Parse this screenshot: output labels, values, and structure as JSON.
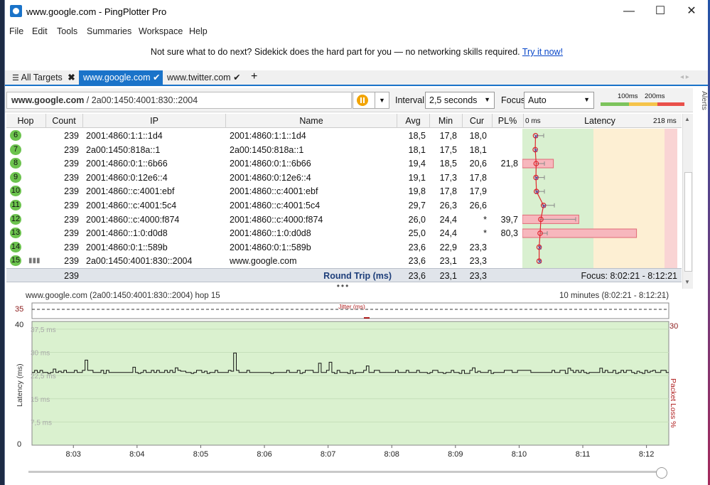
{
  "window": {
    "title": "www.google.com - PingPlotter Pro",
    "minimize": "—",
    "maximize": "☐",
    "close": "✕"
  },
  "menu": [
    "File",
    "Edit",
    "Tools",
    "Summaries",
    "Workspace",
    "Help"
  ],
  "banner": {
    "text": "Not sure what to do next? Sidekick does the hard part for you — no networking skills required.",
    "link": "Try it now!"
  },
  "tabs": {
    "all_targets": "All Targets",
    "items": [
      {
        "label": "www.google.com",
        "active": true
      },
      {
        "label": "www.twitter.com",
        "active": false
      }
    ],
    "add": "+"
  },
  "toolbar": {
    "target": "www.google.com",
    "target_ip": " / 2a00:1450:4001:830::2004",
    "interval_label": "Interval",
    "interval_value": "2,5 seconds",
    "focus_label": "Focus",
    "focus_value": "Auto",
    "scale_100": "100ms",
    "scale_200": "200ms"
  },
  "alerts": "Alerts",
  "columns": {
    "hop": "Hop",
    "count": "Count",
    "ip": "IP",
    "name": "Name",
    "avg": "Avg",
    "min": "Min",
    "cur": "Cur",
    "pl": "PL%",
    "lat_min": "0 ms",
    "latency": "Latency",
    "lat_max": "218 ms"
  },
  "hops": [
    {
      "hop": "6",
      "count": "239",
      "ip": "2001:4860:1:1::1d4",
      "name": "2001:4860:1:1::1d4",
      "avg": "18,5",
      "min": "17,8",
      "cur": "18,0",
      "pl": "",
      "avg_ms": 18.5,
      "min_ms": 17.8,
      "max_ms": 30,
      "pl_pct": 0
    },
    {
      "hop": "7",
      "count": "239",
      "ip": "2a00:1450:818a::1",
      "name": "2a00:1450:818a::1",
      "avg": "18,1",
      "min": "17,5",
      "cur": "18,1",
      "pl": "",
      "avg_ms": 18.1,
      "min_ms": 17.5,
      "max_ms": 18.5,
      "pl_pct": 0
    },
    {
      "hop": "8",
      "count": "239",
      "ip": "2001:4860:0:1::6b66",
      "name": "2001:4860:0:1::6b66",
      "avg": "19,4",
      "min": "18,5",
      "cur": "20,6",
      "pl": "21,8",
      "avg_ms": 19.4,
      "min_ms": 18.5,
      "max_ms": 31,
      "pl_pct": 21.8
    },
    {
      "hop": "9",
      "count": "239",
      "ip": "2001:4860:0:12e6::4",
      "name": "2001:4860:0:12e6::4",
      "avg": "19,1",
      "min": "17,3",
      "cur": "17,8",
      "pl": "",
      "avg_ms": 19.1,
      "min_ms": 17.3,
      "max_ms": 31,
      "pl_pct": 0
    },
    {
      "hop": "10",
      "count": "239",
      "ip": "2001:4860::c:4001:ebf",
      "name": "2001:4860::c:4001:ebf",
      "avg": "19,8",
      "min": "17,8",
      "cur": "17,9",
      "pl": "",
      "avg_ms": 19.8,
      "min_ms": 17.8,
      "max_ms": 31,
      "pl_pct": 0
    },
    {
      "hop": "11",
      "count": "239",
      "ip": "2001:4860::c:4001:5c4",
      "name": "2001:4860::c:4001:5c4",
      "avg": "29,7",
      "min": "26,3",
      "cur": "26,6",
      "pl": "",
      "avg_ms": 29.7,
      "min_ms": 26.3,
      "max_ms": 45,
      "pl_pct": 0
    },
    {
      "hop": "12",
      "count": "239",
      "ip": "2001:4860::c:4000:f874",
      "name": "2001:4860::c:4000:f874",
      "avg": "26,0",
      "min": "24,4",
      "cur": "*",
      "pl": "39,7",
      "avg_ms": 26.0,
      "min_ms": 24.4,
      "max_ms": 75,
      "pl_pct": 39.7
    },
    {
      "hop": "13",
      "count": "239",
      "ip": "2001:4860::1:0:d0d8",
      "name": "2001:4860::1:0:d0d8",
      "avg": "25,0",
      "min": "24,4",
      "cur": "*",
      "pl": "80,3",
      "avg_ms": 25.0,
      "min_ms": 24.4,
      "max_ms": 35,
      "pl_pct": 80.3
    },
    {
      "hop": "14",
      "count": "239",
      "ip": "2001:4860:0:1::589b",
      "name": "2001:4860:0:1::589b",
      "avg": "23,6",
      "min": "22,9",
      "cur": "23,3",
      "pl": "",
      "avg_ms": 23.6,
      "min_ms": 22.9,
      "max_ms": 25,
      "pl_pct": 0
    },
    {
      "hop": "15",
      "count": "239",
      "ip": "2a00:1450:4001:830::2004",
      "name": "www.google.com",
      "avg": "23,6",
      "min": "23,1",
      "cur": "23,3",
      "pl": "",
      "avg_ms": 23.6,
      "min_ms": 23.1,
      "max_ms": 25,
      "pl_pct": 0
    }
  ],
  "footer": {
    "count": "239",
    "label": "Round Trip (ms)",
    "avg": "23,6",
    "min": "23,1",
    "cur": "23,3",
    "focus": "Focus: 8:02:21 - 8:12:21"
  },
  "graph": {
    "header": "www.google.com (2a00:1450:4001:830::2004) hop 15",
    "range": "10 minutes (8:02:21 - 8:12:21)",
    "jitter_label": "Jitter (ms)",
    "jitter_max": "35",
    "ylabel": "Latency (ms)",
    "y2label": "Packet Loss %",
    "y_top": "40",
    "y_bottom": "0",
    "y2_top": "30",
    "gridlines": [
      "37,5 ms",
      "30 ms",
      "22,5 ms",
      "15 ms",
      "7,5 ms"
    ],
    "x_ticks": [
      "8:03",
      "8:04",
      "8:05",
      "8:06",
      "8:07",
      "8:08",
      "8:09",
      "8:10",
      "8:11",
      "8:12"
    ]
  },
  "chart_data": {
    "type": "line",
    "title": "",
    "ylabel": "Latency (ms)",
    "y2label": "Packet Loss %",
    "ylim": [
      0,
      40
    ],
    "y2lim": [
      0,
      30
    ],
    "grid": true,
    "x": [
      "8:03",
      "8:04",
      "8:05",
      "8:06",
      "8:07",
      "8:08",
      "8:09",
      "8:10",
      "8:11",
      "8:12"
    ],
    "baseline_ms": 23.5,
    "spikes": [
      {
        "t": "8:02:40",
        "ms": 24.6
      },
      {
        "t": "8:03:10",
        "ms": 27.5
      },
      {
        "t": "8:03:55",
        "ms": 25.2
      },
      {
        "t": "8:04:35",
        "ms": 25.0
      },
      {
        "t": "8:05:30",
        "ms": 29.8
      },
      {
        "t": "8:06:50",
        "ms": 26.5
      },
      {
        "t": "8:07:00",
        "ms": 26.8
      },
      {
        "t": "8:07:35",
        "ms": 25.6
      },
      {
        "t": "8:09:15",
        "ms": 25.0
      },
      {
        "t": "8:10:45",
        "ms": 24.9
      },
      {
        "t": "8:11:15",
        "ms": 24.9
      }
    ]
  }
}
